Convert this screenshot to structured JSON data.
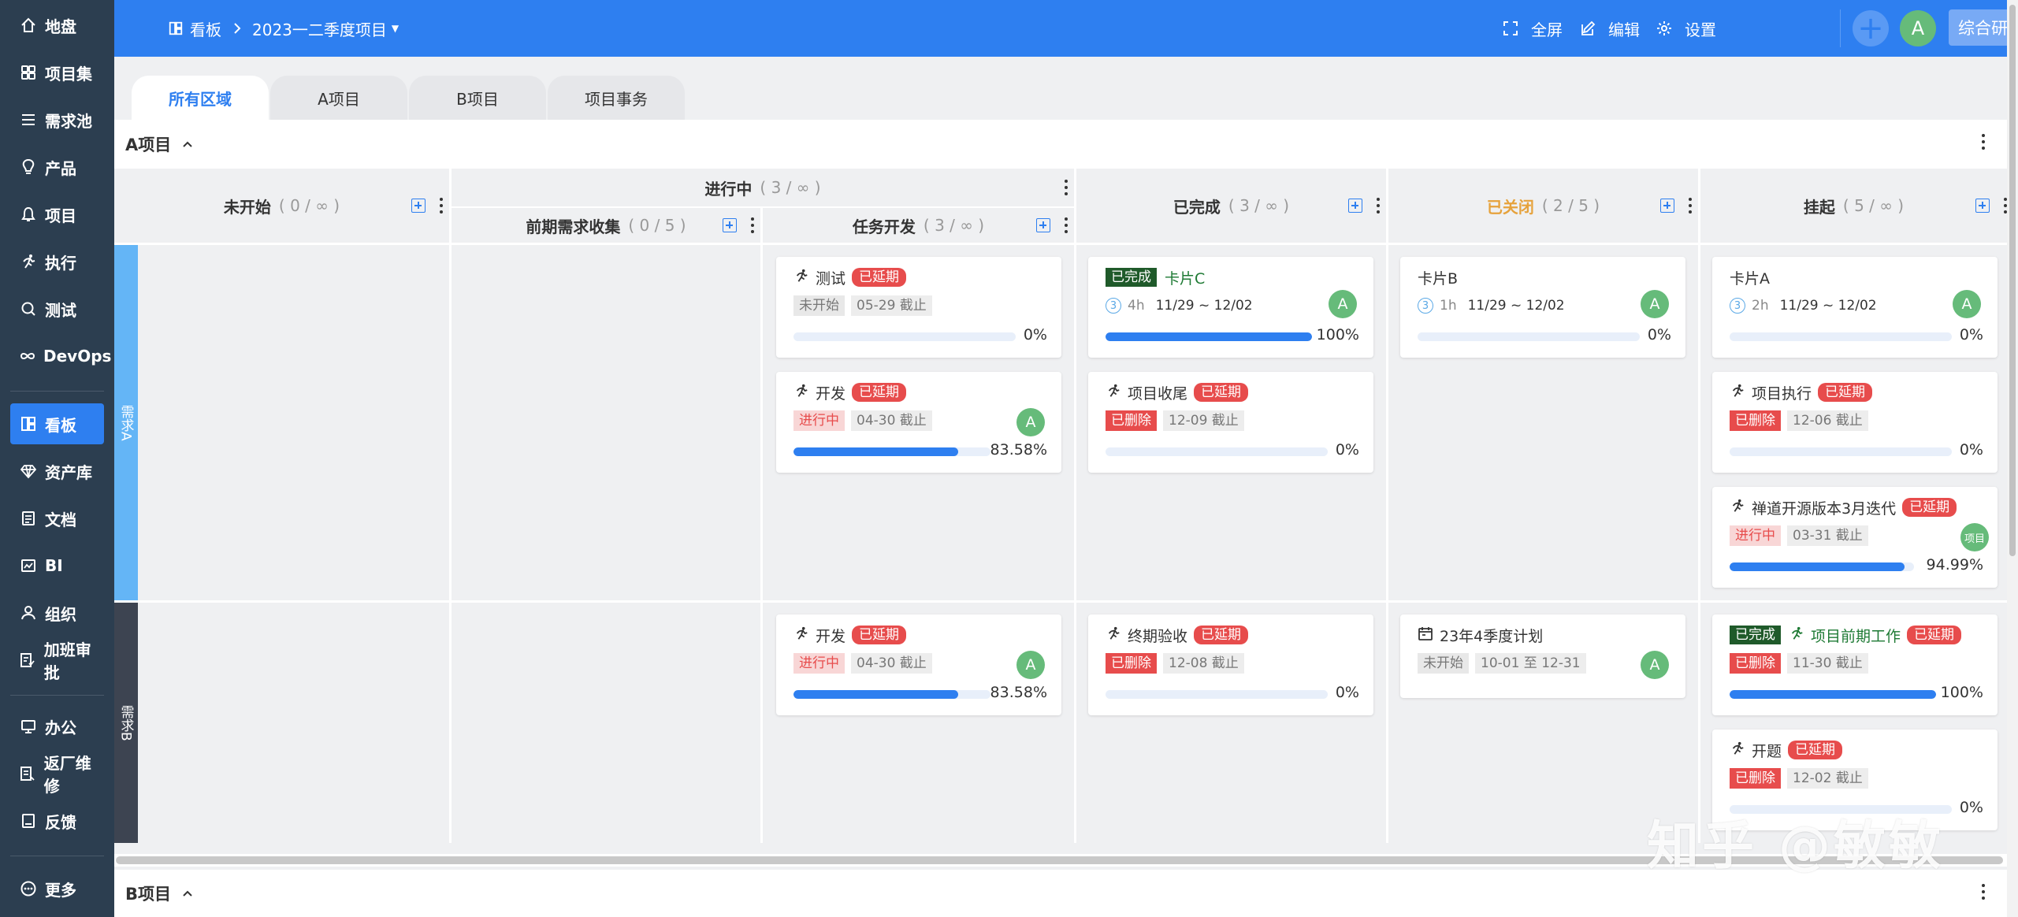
{
  "sidebar": {
    "items": [
      {
        "label": "地盘",
        "icon": "home-icon"
      },
      {
        "label": "项目集",
        "icon": "grid-icon"
      },
      {
        "label": "需求池",
        "icon": "list-icon"
      },
      {
        "label": "产品",
        "icon": "bulb-icon"
      },
      {
        "label": "项目",
        "icon": "bell-icon"
      },
      {
        "label": "执行",
        "icon": "runner-icon"
      },
      {
        "label": "测试",
        "icon": "search-icon"
      },
      {
        "label": "DevOps",
        "icon": "infinity-icon"
      },
      {
        "label": "看板",
        "icon": "kanban-icon"
      },
      {
        "label": "资产库",
        "icon": "diamond-icon"
      },
      {
        "label": "文档",
        "icon": "doc-icon"
      },
      {
        "label": "BI",
        "icon": "chart-icon"
      },
      {
        "label": "组织",
        "icon": "user-icon"
      },
      {
        "label": "加班审批",
        "icon": "approve-icon"
      },
      {
        "label": "办公",
        "icon": "monitor-icon"
      },
      {
        "label": "返厂维修",
        "icon": "repair-icon"
      },
      {
        "label": "反馈",
        "icon": "feedback-icon"
      },
      {
        "label": "更多",
        "icon": "more-icon"
      }
    ]
  },
  "topbar": {
    "board_label": "看板",
    "project_label": "2023一二季度项目",
    "fullscreen": "全屏",
    "edit": "编辑",
    "settings": "设置",
    "avatar": "A",
    "product": "综合研发界面"
  },
  "tabs": [
    {
      "label": "所有区域"
    },
    {
      "label": "A项目"
    },
    {
      "label": "B项目"
    },
    {
      "label": "项目事务"
    }
  ],
  "groups": {
    "a": "A项目",
    "b": "B项目"
  },
  "columns": {
    "not_started": {
      "name": "未开始",
      "count": "( 0 / ∞ )"
    },
    "in_progress": {
      "name": "进行中",
      "count": "( 3 / ∞ )"
    },
    "req_collect": {
      "name": "前期需求收集",
      "count": "( 0 / 5 )"
    },
    "task_dev": {
      "name": "任务开发",
      "count": "( 3 / ∞ )"
    },
    "done": {
      "name": "已完成",
      "count": "( 3 / ∞ )"
    },
    "closed": {
      "name": "已关闭",
      "count": "( 2 / 5 )"
    },
    "suspended": {
      "name": "挂起",
      "count": "( 5 / ∞ )"
    }
  },
  "lanes": {
    "a": "需求A",
    "b": "需求B"
  },
  "cards": {
    "c1": {
      "title": "测试",
      "overdue": "已延期",
      "status": "未开始",
      "due": "05-29 截止",
      "progress": 0,
      "pct": "0%"
    },
    "c2": {
      "title": "开发",
      "overdue": "已延期",
      "status": "进行中",
      "due": "04-30 截止",
      "avatar": "A",
      "progress": 83.58,
      "pct": "83.58%"
    },
    "c3": {
      "done": "已完成",
      "title": "卡片C",
      "est": "3",
      "hours": "4h",
      "range": "11/29 ~ 12/02",
      "avatar": "A",
      "progress": 100,
      "pct": "100%"
    },
    "c4": {
      "title": "项目收尾",
      "overdue": "已延期",
      "status": "已删除",
      "due": "12-09 截止",
      "progress": 0,
      "pct": "0%"
    },
    "c5": {
      "title": "卡片B",
      "est": "3",
      "hours": "1h",
      "range": "11/29 ~ 12/02",
      "avatar": "A",
      "progress": 0,
      "pct": "0%"
    },
    "c6": {
      "title": "卡片A",
      "est": "3",
      "hours": "2h",
      "range": "11/29 ~ 12/02",
      "avatar": "A",
      "progress": 0,
      "pct": "0%"
    },
    "c7": {
      "title": "项目执行",
      "overdue": "已延期",
      "status": "已删除",
      "due": "12-06 截止",
      "progress": 0,
      "pct": "0%"
    },
    "c8": {
      "title": "禅道开源版本3月迭代",
      "overdue": "已延期",
      "status": "进行中",
      "due": "03-31 截止",
      "avatar": "项目",
      "progress": 94.99,
      "pct": "94.99%"
    },
    "c9": {
      "title": "开发",
      "overdue": "已延期",
      "status": "进行中",
      "due": "04-30 截止",
      "avatar": "A",
      "progress": 83.58,
      "pct": "83.58%"
    },
    "c10": {
      "title": "终期验收",
      "overdue": "已延期",
      "status": "已删除",
      "due": "12-08 截止",
      "progress": 0,
      "pct": "0%"
    },
    "c11": {
      "title": "23年4季度计划",
      "status": "未开始",
      "due": "10-01 至 12-31",
      "avatar": "A"
    },
    "c12": {
      "done": "已完成",
      "title": "项目前期工作",
      "overdue": "已延期",
      "status": "已删除",
      "due": "11-30 截止",
      "progress": 100,
      "pct": "100%"
    },
    "c13": {
      "title": "开题",
      "overdue": "已延期",
      "status": "已删除",
      "due": "12-02 截止",
      "progress": 0,
      "pct": "0%"
    }
  },
  "colors": {
    "primary": "#2e7ff0",
    "sidebar": "#2c3e50",
    "lane_a": "#64b5f6",
    "lane_b": "#3d4451",
    "overdue": "#e74c4c",
    "closed_heading": "#e6a23c"
  },
  "watermark": "知乎 @敏敏"
}
